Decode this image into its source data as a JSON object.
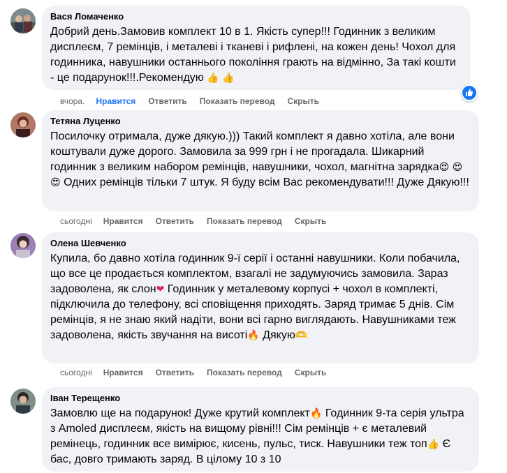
{
  "actions": {
    "like": "Нравится",
    "reply": "Ответить",
    "translate": "Показать перевод",
    "hide": "Скрыть"
  },
  "comments": [
    {
      "author": "Вася Ломаченко",
      "time": "вчора.",
      "text": "Добрий день.Замовив комплект 10 в 1. Якість супер!!! Годинник з великим дисплеєм, 7 ремінців, і металеві і тканеві і рифлені, на кожен день! Чохол для годинника, навушники останнього покоління грають на відмінно, За такі кошти - це подарунок!!!.Рекомендую",
      "emoji": "👍 👍",
      "liked": true
    },
    {
      "author": "Тетяна Луценко",
      "time": "сьогодні",
      "text_a": "Посилочку отримала, дуже дякую.))) Такий комплект я давно хотіла, але вони коштували дуже дорого. Замовила за 999 грн і не прогадала. Шикарний годинник з великим набором ремінців, навушники, чохол, магнітна зарядка",
      "emoji": "😍 😍 😍",
      "text_b": "Одних ремінців тільки 7 штук. Я буду всім Вас рекомендувати!!! Дуже Дякую!!!"
    },
    {
      "author": "Олена Шевченко",
      "time": "сьогодні",
      "text_a": "Купила, бо давно хотіла годинник 9-ї серії і останні навушники. Коли побачила, що все це продається комплектом, взагалі не задумуючись замовила. Зараз задоволена, як слон",
      "emoji_a": "❤",
      "text_b": "Годинник у металевому корпусі + чохол в комплекті, підключила до телефону, всі сповіщення приходять. Заряд тримає 5 днів. Сім ремінців, я не знаю який надіти, вони всі гарно виглядають. Навушниками теж задоволена, якість звучання на висоті",
      "emoji_b": "🔥",
      "text_c": "Дякую",
      "emoji_c": "🫶"
    },
    {
      "author": "Іван Терещенко",
      "text_a": "Замовлю ще на подарунок! Дуже крутий комплект",
      "emoji_a": "🔥",
      "text_b": "Годинник 9-та серія ультра з Amoled дисплеєм, якість на вищому рівні!!! Сім ремінців + є металевий ремінець, годинник все вимірює, кисень, пульс, тиск. Навушники теж топ",
      "emoji_b": "👍",
      "text_c": "Є бас, довго тримають заряд. В цілому 10 з 10"
    }
  ],
  "reaction_icon": "thumbs-up-icon",
  "colors": {
    "bubble": "#f0f2f5",
    "meta": "#65676b",
    "liked": "#2078f4",
    "reaction": "#1877f2"
  }
}
